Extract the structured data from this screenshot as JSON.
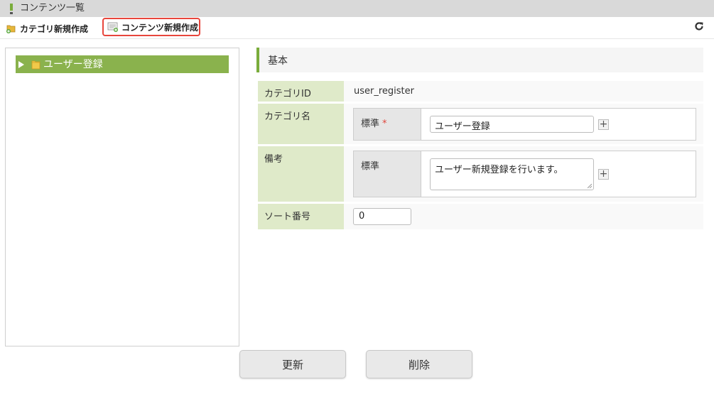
{
  "window": {
    "title": "コンテンツ一覧"
  },
  "toolbar": {
    "create_category": "カテゴリ新規作成",
    "create_content": "コンテンツ新規作成",
    "refresh_icon": "refresh-icon"
  },
  "tree": {
    "items": [
      {
        "label": "ユーザー登録",
        "selected": true
      }
    ]
  },
  "detail": {
    "section_title": "基本",
    "fields": {
      "category_id": {
        "label": "カテゴリID",
        "value": "user_register"
      },
      "category_name": {
        "label": "カテゴリ名",
        "lang": "標準",
        "required_mark": "*",
        "value": "ユーザー登録"
      },
      "remarks": {
        "label": "備考",
        "lang": "標準",
        "value": "ユーザー新規登録を行います。"
      },
      "sort_order": {
        "label": "ソート番号",
        "value": "0"
      }
    }
  },
  "actions": {
    "update": "更新",
    "delete": "削除"
  },
  "colors": {
    "accent_green": "#8ab24d",
    "label_bg": "#dfeac9",
    "highlight_red": "#e8463c"
  }
}
